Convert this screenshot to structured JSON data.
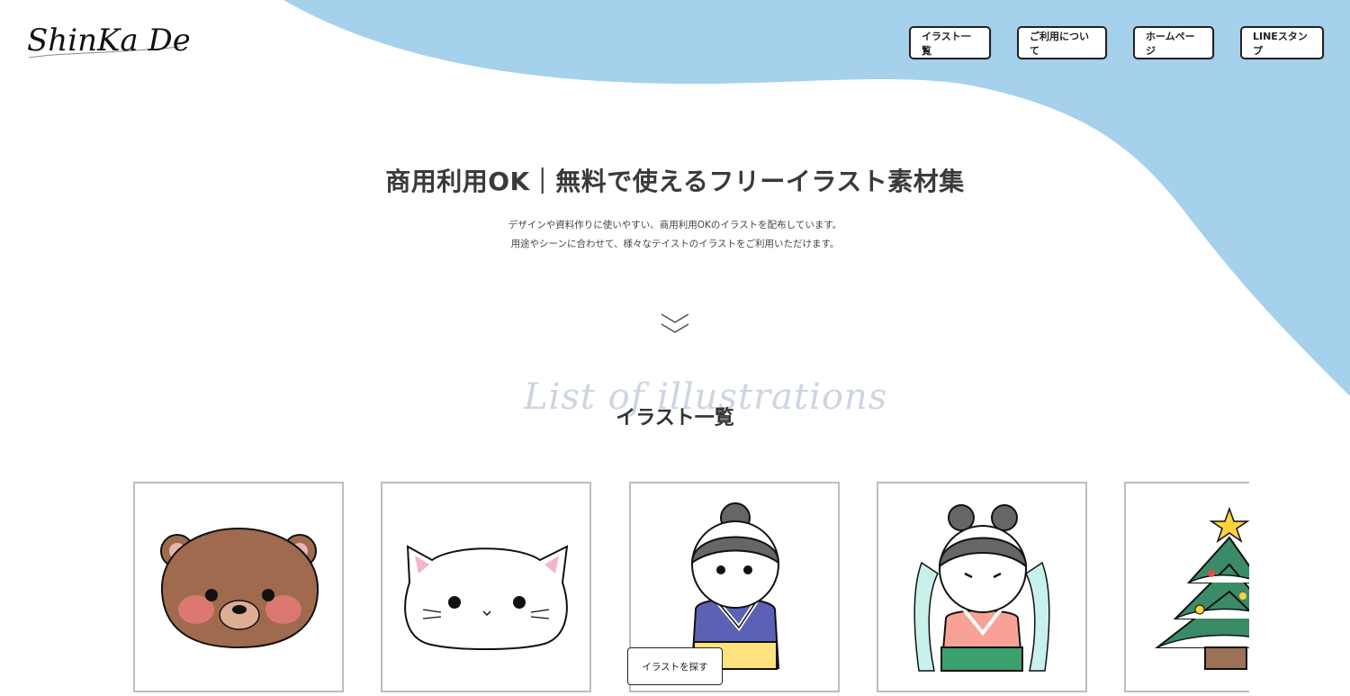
{
  "logo": {
    "text": "ShinKa Design"
  },
  "nav": [
    {
      "label": "イラスト一覧"
    },
    {
      "label": "ご利用について"
    },
    {
      "label": "ホームページ"
    },
    {
      "label": "LINEスタンプ"
    }
  ],
  "hero": {
    "title": "商用利用OK｜無料で使えるフリーイラスト素材集",
    "description_lines": [
      "デザインや資料作りに使いやすい、商用利用OKのイラストを配布しています。",
      "用途やシーンに合わせて、様々なテイストのイラストをご利用いただけます。"
    ]
  },
  "section": {
    "script_text": "List of illustrations",
    "title": "イラスト一覧"
  },
  "gallery": {
    "items": [
      {
        "icon": "bear-illustration"
      },
      {
        "icon": "cat-illustration"
      },
      {
        "icon": "kimono-girl-illustration"
      },
      {
        "icon": "orihime-illustration"
      },
      {
        "icon": "christmas-tree-illustration"
      }
    ]
  },
  "cta": {
    "label": "イラストを探す"
  },
  "colors": {
    "accent_blue": "#a6d1ec",
    "border": "#222222"
  }
}
